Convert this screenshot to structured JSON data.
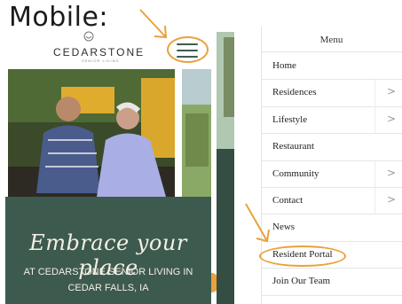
{
  "heading": "Mobile:",
  "brand": {
    "name": "CEDARSTONE",
    "tagline": "SENIOR LIVING"
  },
  "hero": {
    "script_text": "Embrace your place",
    "line1": "AT CEDARSTONE SENIOR LIVING IN",
    "line2": "CEDAR FALLS, IA"
  },
  "menu": {
    "title": "Menu",
    "items": [
      {
        "label": "Home",
        "has_submenu": false
      },
      {
        "label": "Residences",
        "has_submenu": true
      },
      {
        "label": "Lifestyle",
        "has_submenu": true
      },
      {
        "label": "Restaurant",
        "has_submenu": false
      },
      {
        "label": "Community",
        "has_submenu": true
      },
      {
        "label": "Contact",
        "has_submenu": true
      },
      {
        "label": "News",
        "has_submenu": false
      },
      {
        "label": "Resident Portal",
        "has_submenu": false
      },
      {
        "label": "Join Our Team",
        "has_submenu": false
      }
    ],
    "chevron": ">"
  },
  "colors": {
    "annotation": "#e8a23b",
    "brand_green": "#3d5a4f"
  }
}
